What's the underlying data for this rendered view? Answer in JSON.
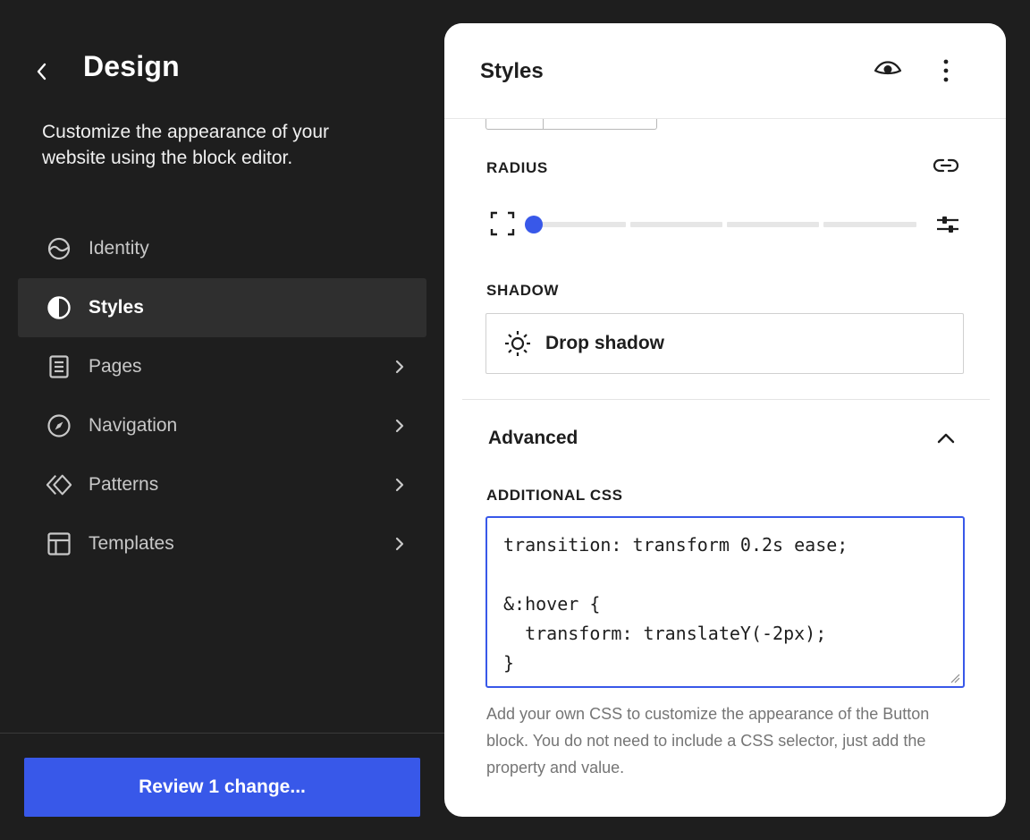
{
  "sidebar": {
    "title": "Design",
    "description": "Customize the appearance of your website using the block editor.",
    "items": [
      {
        "label": "Identity",
        "icon": "identity-icon",
        "active": false,
        "has_chevron": false
      },
      {
        "label": "Styles",
        "icon": "half-circle-icon",
        "active": true,
        "has_chevron": false
      },
      {
        "label": "Pages",
        "icon": "page-icon",
        "active": false,
        "has_chevron": true
      },
      {
        "label": "Navigation",
        "icon": "compass-icon",
        "active": false,
        "has_chevron": true
      },
      {
        "label": "Patterns",
        "icon": "patterns-icon",
        "active": false,
        "has_chevron": true
      },
      {
        "label": "Templates",
        "icon": "layout-icon",
        "active": false,
        "has_chevron": true
      }
    ],
    "review_button": "Review 1 change..."
  },
  "panel": {
    "title": "Styles",
    "radius": {
      "label": "RADIUS",
      "slider_value": 0
    },
    "shadow": {
      "label": "SHADOW",
      "option": "Drop shadow"
    },
    "advanced": {
      "title": "Advanced",
      "expanded": true,
      "css_label": "ADDITIONAL CSS",
      "css_lines": [
        "transition: transform 0.2s ease;",
        "",
        "&:hover {",
        "  transform: translateY(-2px);",
        "}"
      ],
      "help": "Add your own CSS to customize the appearance of the Button block. You do not need to include a CSS selector, just add the property and value."
    }
  },
  "colors": {
    "accent": "#3858e9",
    "sidebar_bg": "#1e1e1e",
    "active_item_bg": "#2f2f2f",
    "panel_bg": "#ffffff"
  }
}
